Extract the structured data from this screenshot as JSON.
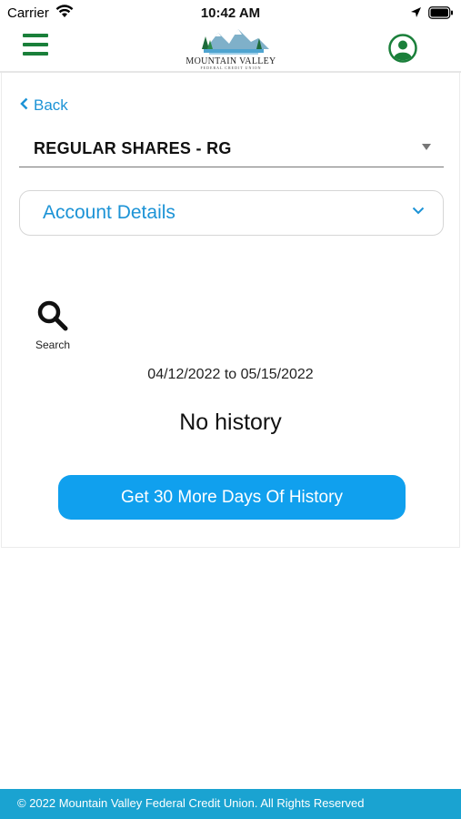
{
  "status_bar": {
    "carrier": "Carrier",
    "time": "10:42 AM"
  },
  "header": {
    "logo": {
      "name": "MOUNTAIN VALLEY",
      "subtitle": "FEDERAL CREDIT UNION"
    },
    "menu_icon": "hamburger-icon",
    "profile_icon": "user-icon",
    "brand_color": "#1a7f3a"
  },
  "nav": {
    "back_label": "Back"
  },
  "account": {
    "selected": "REGULAR SHARES - RG"
  },
  "details_panel": {
    "label": "Account Details"
  },
  "search": {
    "label": "Search"
  },
  "history": {
    "date_range": "04/12/2022 to 05/15/2022",
    "empty_message": "No history",
    "more_button_label": "Get 30 More Days Of History"
  },
  "footer": {
    "copyright": "© 2022 Mountain Valley Federal Credit Union. All Rights Reserved"
  },
  "colors": {
    "accent": "#1c93d6",
    "button": "#10a0ee",
    "footer": "#1aa3d1"
  }
}
